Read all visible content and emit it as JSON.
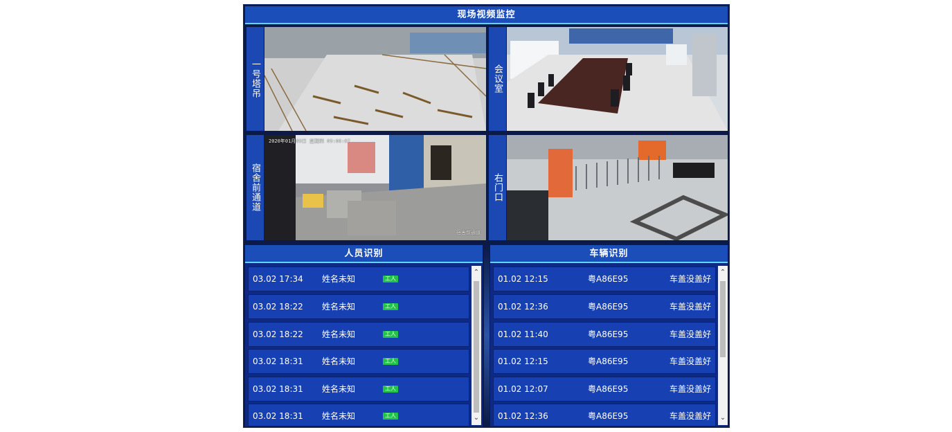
{
  "video": {
    "title": "现场视频监控",
    "cameras": [
      {
        "label": "一号塔吊"
      },
      {
        "label": "会议室"
      },
      {
        "label": "宿舍前通道",
        "timestamp": "2020年01月09日 星期四 09:06:07",
        "name_overlay": "宿舍前通道"
      },
      {
        "label": "右门口"
      }
    ]
  },
  "personnel": {
    "title": "人员识别",
    "rows": [
      {
        "time": "03.02 17:34",
        "name": "姓名未知",
        "tag": "工人"
      },
      {
        "time": "03.02 18:22",
        "name": "姓名未知",
        "tag": "工人"
      },
      {
        "time": "03.02 18:22",
        "name": "姓名未知",
        "tag": "工人"
      },
      {
        "time": "03.02 18:31",
        "name": "姓名未知",
        "tag": "工人"
      },
      {
        "time": "03.02 18:31",
        "name": "姓名未知",
        "tag": "工人"
      },
      {
        "time": "03.02 18:31",
        "name": "姓名未知",
        "tag": "工人"
      }
    ]
  },
  "vehicles": {
    "title": "车辆识别",
    "rows": [
      {
        "time": "01.02 12:15",
        "plate": "粤A86E95",
        "status": "车盖没盖好"
      },
      {
        "time": "01.02 12:36",
        "plate": "粤A86E95",
        "status": "车盖没盖好"
      },
      {
        "time": "01.02 11:40",
        "plate": "粤A86E95",
        "status": "车盖没盖好"
      },
      {
        "time": "01.02 12:15",
        "plate": "粤A86E95",
        "status": "车盖没盖好"
      },
      {
        "time": "01.02 12:07",
        "plate": "粤A86E95",
        "status": "车盖没盖好"
      },
      {
        "time": "01.02 12:36",
        "plate": "粤A86E95",
        "status": "车盖没盖好"
      }
    ]
  },
  "scroll": {
    "up": "⌃",
    "down": "⌄"
  },
  "colors": {
    "panel": "#1741b2",
    "header": "#1b4eb8",
    "accent": "#5fd4ff",
    "badge": "#23c24a"
  }
}
